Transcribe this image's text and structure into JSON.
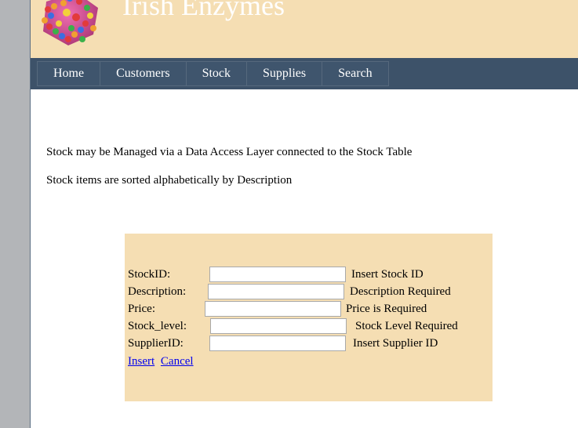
{
  "site": {
    "title": "Irish Enzymes",
    "logo": "molecule-cluster-logo"
  },
  "nav": {
    "items": [
      {
        "label": "Home"
      },
      {
        "label": "Customers"
      },
      {
        "label": "Stock"
      },
      {
        "label": "Supplies"
      },
      {
        "label": "Search"
      }
    ]
  },
  "intro": {
    "line1": "Stock may be Managed via a Data Access Layer connected to the Stock Table",
    "line2": "Stock items are sorted alphabetically by Description"
  },
  "form": {
    "fields": [
      {
        "label": "StockID:",
        "value": "",
        "message": "Insert Stock ID"
      },
      {
        "label": "Description:",
        "value": "",
        "message": "Description Required"
      },
      {
        "label": "Price:",
        "value": "",
        "message": "Price is Required"
      },
      {
        "label": "Stock_level:",
        "value": "",
        "message": "Stock Level Required"
      },
      {
        "label": "SupplierID:",
        "value": "",
        "message": "Insert Supplier ID"
      }
    ],
    "insert_label": "Insert",
    "cancel_label": "Cancel"
  },
  "colors": {
    "banner": "#f5deb3",
    "navbar": "#3d5269",
    "gutter": "#b3b5b8",
    "link": "#0000ee"
  }
}
